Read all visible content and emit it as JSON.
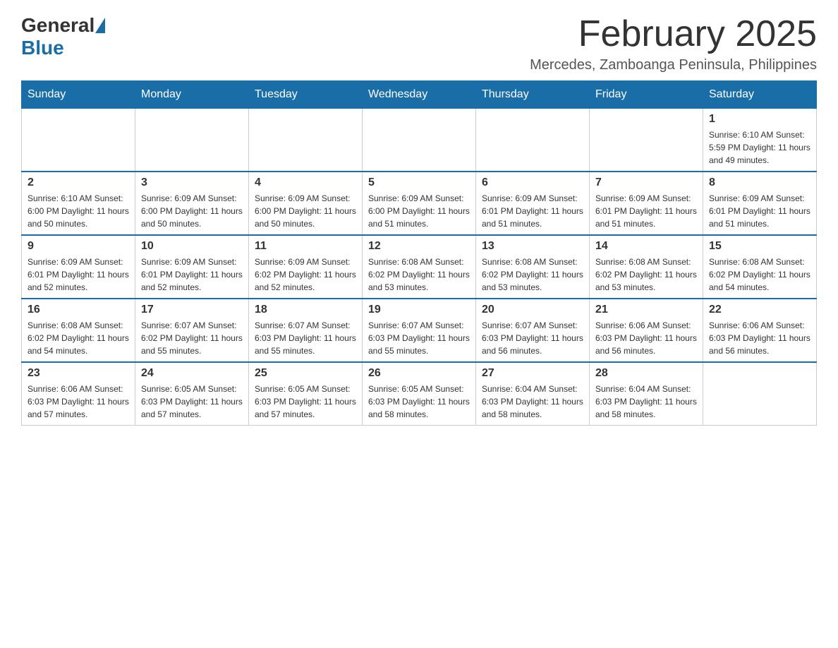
{
  "logo": {
    "general": "General",
    "blue": "Blue"
  },
  "title": "February 2025",
  "subtitle": "Mercedes, Zamboanga Peninsula, Philippines",
  "weekdays": [
    "Sunday",
    "Monday",
    "Tuesday",
    "Wednesday",
    "Thursday",
    "Friday",
    "Saturday"
  ],
  "weeks": [
    [
      {
        "day": "",
        "info": ""
      },
      {
        "day": "",
        "info": ""
      },
      {
        "day": "",
        "info": ""
      },
      {
        "day": "",
        "info": ""
      },
      {
        "day": "",
        "info": ""
      },
      {
        "day": "",
        "info": ""
      },
      {
        "day": "1",
        "info": "Sunrise: 6:10 AM\nSunset: 5:59 PM\nDaylight: 11 hours and 49 minutes."
      }
    ],
    [
      {
        "day": "2",
        "info": "Sunrise: 6:10 AM\nSunset: 6:00 PM\nDaylight: 11 hours and 50 minutes."
      },
      {
        "day": "3",
        "info": "Sunrise: 6:09 AM\nSunset: 6:00 PM\nDaylight: 11 hours and 50 minutes."
      },
      {
        "day": "4",
        "info": "Sunrise: 6:09 AM\nSunset: 6:00 PM\nDaylight: 11 hours and 50 minutes."
      },
      {
        "day": "5",
        "info": "Sunrise: 6:09 AM\nSunset: 6:00 PM\nDaylight: 11 hours and 51 minutes."
      },
      {
        "day": "6",
        "info": "Sunrise: 6:09 AM\nSunset: 6:01 PM\nDaylight: 11 hours and 51 minutes."
      },
      {
        "day": "7",
        "info": "Sunrise: 6:09 AM\nSunset: 6:01 PM\nDaylight: 11 hours and 51 minutes."
      },
      {
        "day": "8",
        "info": "Sunrise: 6:09 AM\nSunset: 6:01 PM\nDaylight: 11 hours and 51 minutes."
      }
    ],
    [
      {
        "day": "9",
        "info": "Sunrise: 6:09 AM\nSunset: 6:01 PM\nDaylight: 11 hours and 52 minutes."
      },
      {
        "day": "10",
        "info": "Sunrise: 6:09 AM\nSunset: 6:01 PM\nDaylight: 11 hours and 52 minutes."
      },
      {
        "day": "11",
        "info": "Sunrise: 6:09 AM\nSunset: 6:02 PM\nDaylight: 11 hours and 52 minutes."
      },
      {
        "day": "12",
        "info": "Sunrise: 6:08 AM\nSunset: 6:02 PM\nDaylight: 11 hours and 53 minutes."
      },
      {
        "day": "13",
        "info": "Sunrise: 6:08 AM\nSunset: 6:02 PM\nDaylight: 11 hours and 53 minutes."
      },
      {
        "day": "14",
        "info": "Sunrise: 6:08 AM\nSunset: 6:02 PM\nDaylight: 11 hours and 53 minutes."
      },
      {
        "day": "15",
        "info": "Sunrise: 6:08 AM\nSunset: 6:02 PM\nDaylight: 11 hours and 54 minutes."
      }
    ],
    [
      {
        "day": "16",
        "info": "Sunrise: 6:08 AM\nSunset: 6:02 PM\nDaylight: 11 hours and 54 minutes."
      },
      {
        "day": "17",
        "info": "Sunrise: 6:07 AM\nSunset: 6:02 PM\nDaylight: 11 hours and 55 minutes."
      },
      {
        "day": "18",
        "info": "Sunrise: 6:07 AM\nSunset: 6:03 PM\nDaylight: 11 hours and 55 minutes."
      },
      {
        "day": "19",
        "info": "Sunrise: 6:07 AM\nSunset: 6:03 PM\nDaylight: 11 hours and 55 minutes."
      },
      {
        "day": "20",
        "info": "Sunrise: 6:07 AM\nSunset: 6:03 PM\nDaylight: 11 hours and 56 minutes."
      },
      {
        "day": "21",
        "info": "Sunrise: 6:06 AM\nSunset: 6:03 PM\nDaylight: 11 hours and 56 minutes."
      },
      {
        "day": "22",
        "info": "Sunrise: 6:06 AM\nSunset: 6:03 PM\nDaylight: 11 hours and 56 minutes."
      }
    ],
    [
      {
        "day": "23",
        "info": "Sunrise: 6:06 AM\nSunset: 6:03 PM\nDaylight: 11 hours and 57 minutes."
      },
      {
        "day": "24",
        "info": "Sunrise: 6:05 AM\nSunset: 6:03 PM\nDaylight: 11 hours and 57 minutes."
      },
      {
        "day": "25",
        "info": "Sunrise: 6:05 AM\nSunset: 6:03 PM\nDaylight: 11 hours and 57 minutes."
      },
      {
        "day": "26",
        "info": "Sunrise: 6:05 AM\nSunset: 6:03 PM\nDaylight: 11 hours and 58 minutes."
      },
      {
        "day": "27",
        "info": "Sunrise: 6:04 AM\nSunset: 6:03 PM\nDaylight: 11 hours and 58 minutes."
      },
      {
        "day": "28",
        "info": "Sunrise: 6:04 AM\nSunset: 6:03 PM\nDaylight: 11 hours and 58 minutes."
      },
      {
        "day": "",
        "info": ""
      }
    ]
  ]
}
